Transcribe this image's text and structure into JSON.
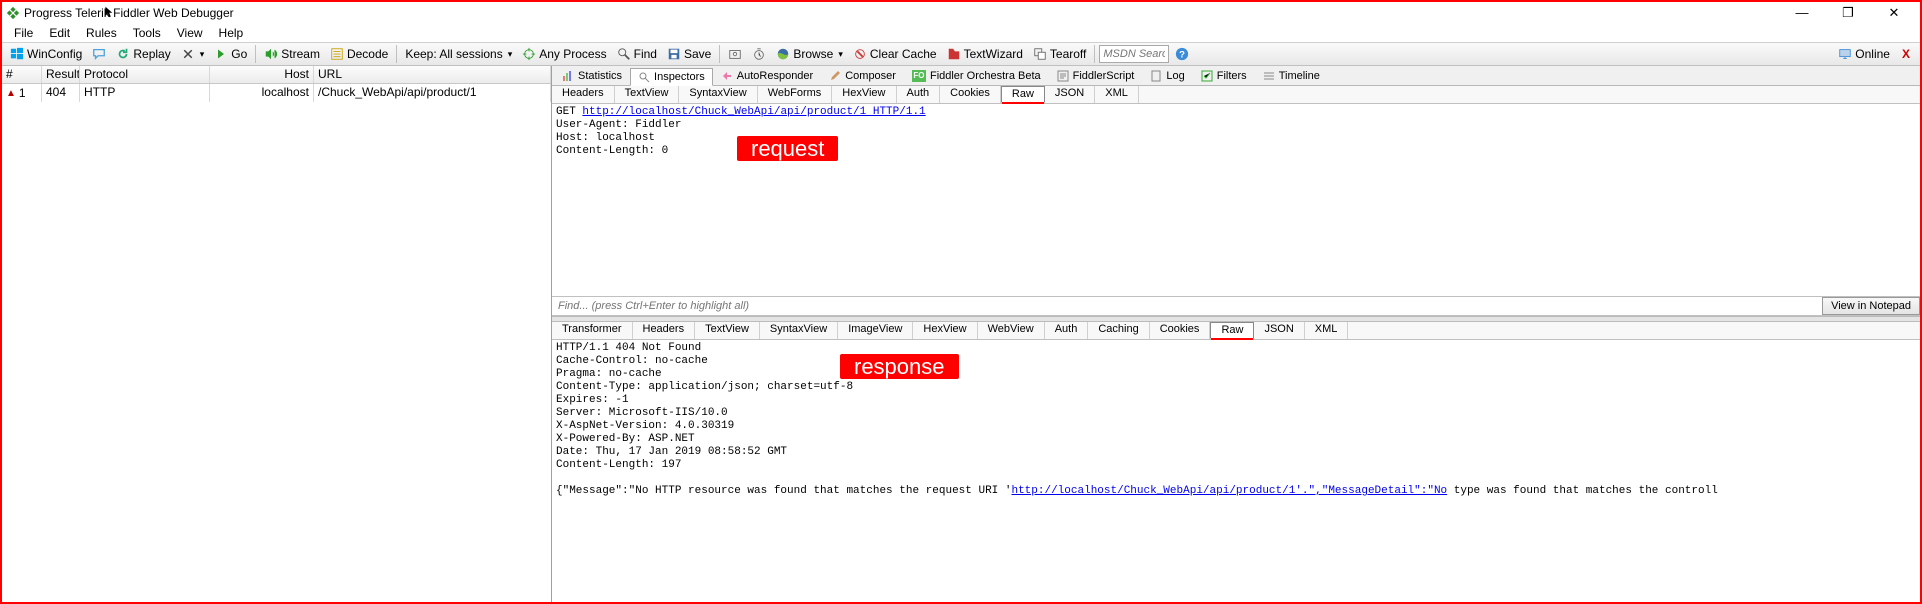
{
  "window": {
    "title": "Progress Telerik Fiddler Web Debugger",
    "minimize": "—",
    "maximize": "❐",
    "close": "✕"
  },
  "menu": [
    "File",
    "Edit",
    "Rules",
    "Tools",
    "View",
    "Help"
  ],
  "toolbar": {
    "winconfig": "WinConfig",
    "replay": "Replay",
    "go": "Go",
    "stream": "Stream",
    "decode": "Decode",
    "keep": "Keep: All sessions",
    "anyprocess": "Any Process",
    "find": "Find",
    "save": "Save",
    "browse": "Browse",
    "clearcache": "Clear Cache",
    "textwizard": "TextWizard",
    "tearoff": "Tearoff",
    "search_placeholder": "MSDN Search...",
    "online": "Online",
    "close_x": "X"
  },
  "sessions": {
    "headers": {
      "num": "#",
      "result": "Result",
      "protocol": "Protocol",
      "host": "Host",
      "url": "URL"
    },
    "rows": [
      {
        "num": "1",
        "result": "404",
        "protocol": "HTTP",
        "host": "localhost",
        "url": "/Chuck_WebApi/api/product/1"
      }
    ]
  },
  "main_tabs": [
    "Statistics",
    "Inspectors",
    "AutoResponder",
    "Composer",
    "Fiddler Orchestra Beta",
    "FiddlerScript",
    "Log",
    "Filters",
    "Timeline"
  ],
  "main_tab_selected": 1,
  "req_tabs": [
    "Headers",
    "TextView",
    "SyntaxView",
    "WebForms",
    "HexView",
    "Auth",
    "Cookies",
    "Raw",
    "JSON",
    "XML"
  ],
  "req_tab_selected": 7,
  "request": {
    "method": "GET ",
    "url": "http://localhost/Chuck_WebApi/api/product/1 HTTP/1.1",
    "lines": "User-Agent: Fiddler\nHost: localhost\nContent-Length: 0"
  },
  "find": {
    "placeholder": "Find... (press Ctrl+Enter to highlight all)",
    "button": "View in Notepad"
  },
  "resp_tabs": [
    "Transformer",
    "Headers",
    "TextView",
    "SyntaxView",
    "ImageView",
    "HexView",
    "WebView",
    "Auth",
    "Caching",
    "Cookies",
    "Raw",
    "JSON",
    "XML"
  ],
  "resp_tab_selected": 10,
  "response": {
    "raw_pre": "HTTP/1.1 404 Not Found\nCache-Control: no-cache\nPragma: no-cache\nContent-Type: application/json; charset=utf-8\nExpires: -1\nServer: Microsoft-IIS/10.0\nX-AspNet-Version: 4.0.30319\nX-Powered-By: ASP.NET\nDate: Thu, 17 Jan 2019 08:58:52 GMT\nContent-Length: 197\n\n{\"Message\":\"No HTTP resource was found that matches the request URI '",
    "link": "http://localhost/Chuck_WebApi/api/product/1'.\",\"MessageDetail\":\"No",
    "raw_post": " type was found that matches the controll"
  },
  "annotations": {
    "request": "request",
    "response": "response"
  }
}
